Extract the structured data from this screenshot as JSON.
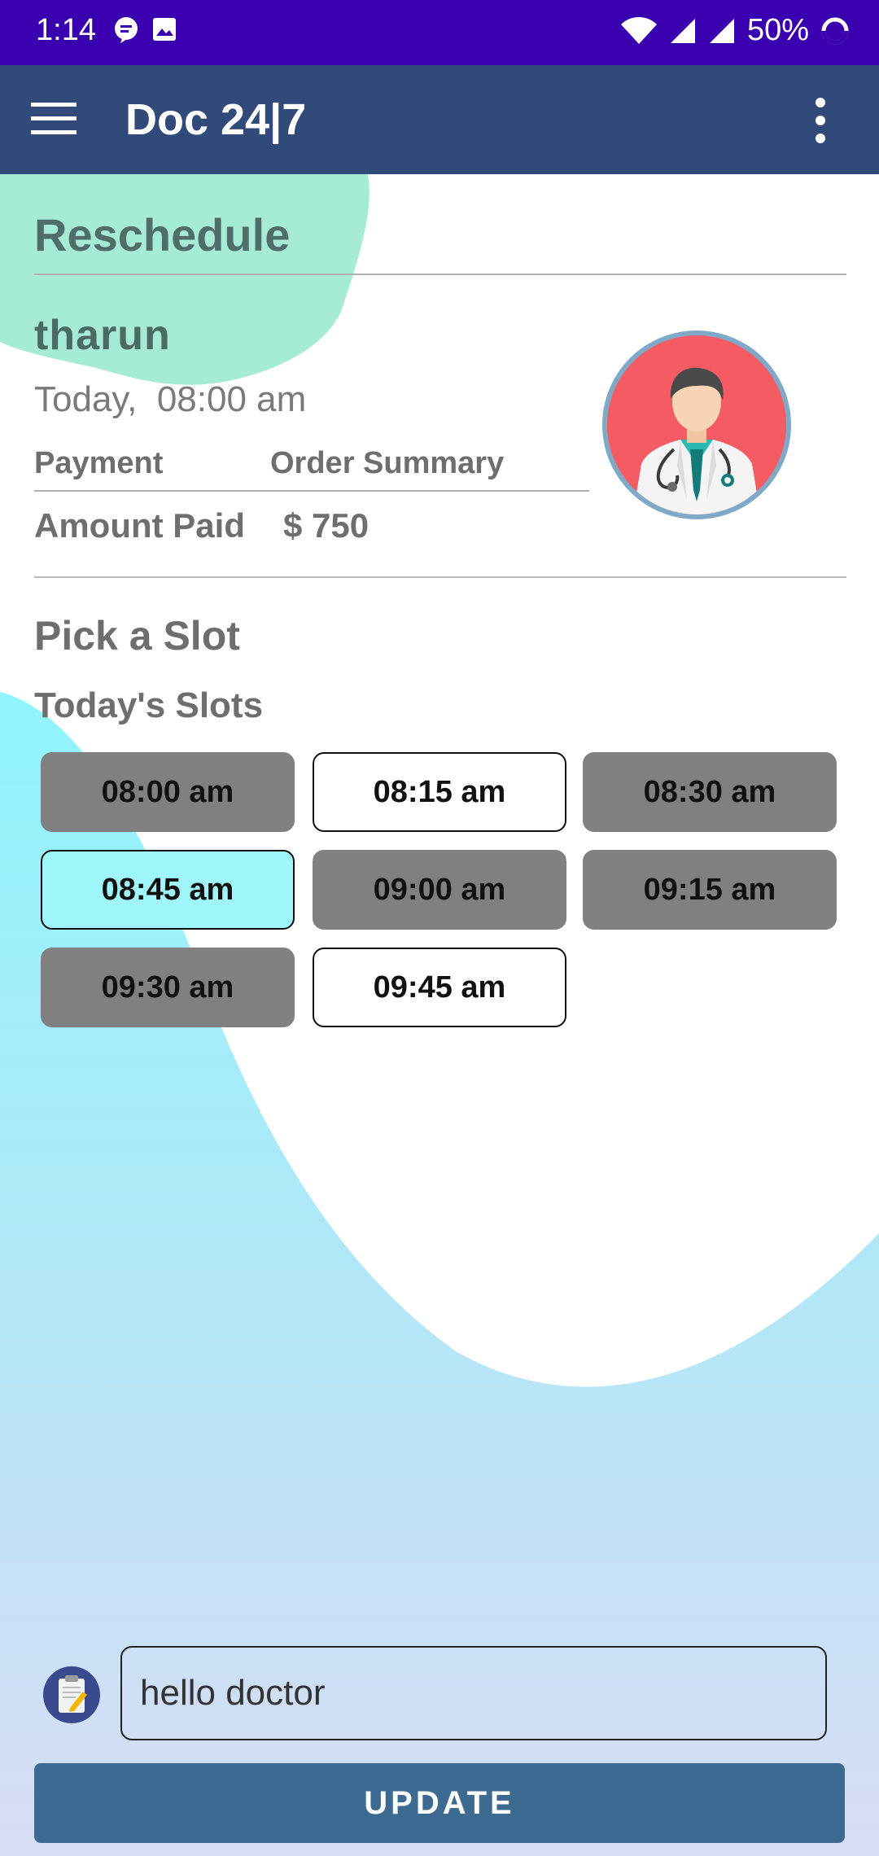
{
  "status_bar": {
    "time": "1:14",
    "battery": "50%",
    "icons_left": [
      "chat-bubble-icon",
      "image-icon"
    ],
    "icons_right": [
      "wifi-icon",
      "signal-icon",
      "signal-icon",
      "battery-ring-icon"
    ]
  },
  "app_bar": {
    "title": "Doc 24|7",
    "menu_icon": "menu-icon",
    "overflow_icon": "overflow-menu-icon",
    "color": "#314a7a"
  },
  "reschedule": {
    "title": "Reschedule",
    "patient_name": "tharun",
    "appointment": "Today,  08:00 am",
    "payment_label": "Payment",
    "order_summary_label": "Order Summary",
    "amount_label": "Amount Paid",
    "amount_value": "$ 750"
  },
  "slots": {
    "title": "Pick a Slot",
    "subtitle": "Today's Slots",
    "items": [
      {
        "label": "08:00 am",
        "state": "booked"
      },
      {
        "label": "08:15 am",
        "state": "free"
      },
      {
        "label": "08:30 am",
        "state": "booked"
      },
      {
        "label": "08:45 am",
        "state": "selected"
      },
      {
        "label": "09:00 am",
        "state": "booked"
      },
      {
        "label": "09:15 am",
        "state": "booked"
      },
      {
        "label": "09:30 am",
        "state": "booked"
      },
      {
        "label": "09:45 am",
        "state": "free"
      }
    ]
  },
  "note": {
    "icon": "clipboard-icon",
    "value": "hello doctor"
  },
  "actions": {
    "update_label": "UPDATE",
    "button_color": "#3c6a90"
  },
  "colors": {
    "status_bar": "#3a00b0",
    "accent_green": "#5fd9b3",
    "accent_cyan": "#9ff7fb",
    "booked_slot": "#808080"
  }
}
